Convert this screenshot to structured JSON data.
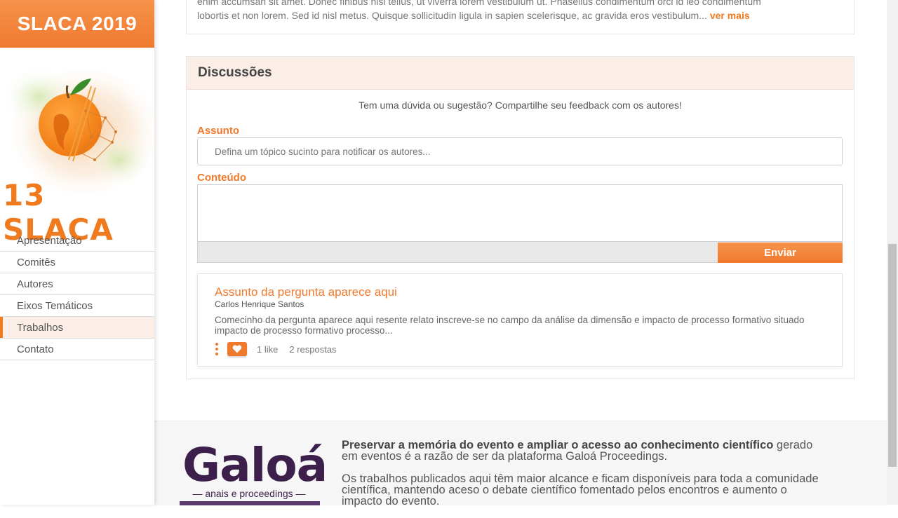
{
  "sidebar": {
    "brand": "SLACA 2019",
    "logo_text": "13 SLACA",
    "items": [
      {
        "label": "Apresentação",
        "active": false
      },
      {
        "label": "Comitês",
        "active": false
      },
      {
        "label": "Autores",
        "active": false
      },
      {
        "label": "Eixos Temáticos",
        "active": false
      },
      {
        "label": "Trabalhos",
        "active": true
      },
      {
        "label": "Contato",
        "active": false
      }
    ]
  },
  "abstract": {
    "line1": "enim accumsan sit amet. Donec finibus nisi tellus, ut viverra lorem vestibulum ut. Phasellus condimentum orci id leo condimentum",
    "line2": "lobortis et non lorem. Sed id nisl metus. Quisque sollicitudin ligula in sapien scelerisque, ac gravida eros vestibulum...",
    "more": "ver mais"
  },
  "discussion": {
    "title": "Discussões",
    "subtitle": "Tem uma dúvida ou sugestão? Compartilhe seu feedback com os autores!",
    "subject_label": "Assunto",
    "subject_placeholder": "Defina um tópico sucinto para notificar os autores...",
    "content_label": "Conteúdo",
    "send_label": "Enviar",
    "question": {
      "title": "Assunto da pergunta aparece aqui",
      "author": "Carlos Henrique Santos",
      "body": "Comecinho da pergunta aparece aqui resente relato inscreve-se no campo da análise da dimensão e impacto de processo formativo situado impacto de processo formativo processo...",
      "likes": "1 like",
      "replies": "2 respostas"
    }
  },
  "footer": {
    "brand": "Galoá",
    "brand_sub": "— anais e proceedings —",
    "p1_bold": "Preservar a memória do evento e ampliar o acesso ao conhecimento científico",
    "p1_rest": " gerado em eventos é a razão de ser da plataforma Galoá Proceedings.",
    "p2": "Os trabalhos publicados aqui têm maior alcance e ficam disponíveis para toda a comunidade científica, mantendo aceso o debate científico fomentado pelos encontros e aumento o impacto do evento."
  },
  "colors": {
    "accent": "#ef7a2c",
    "header_bg": "#fbeee6",
    "galoa_purple": "#3c1f4a"
  }
}
